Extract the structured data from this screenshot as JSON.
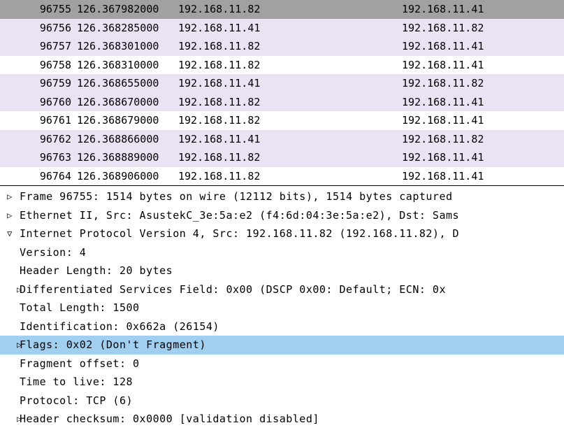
{
  "packet_list": {
    "rows": [
      {
        "no": "96755",
        "time": "126.367982000",
        "src": "192.168.11.82",
        "dst": "192.168.11.41",
        "style": "selected"
      },
      {
        "no": "96756",
        "time": "126.368285000",
        "src": "192.168.11.41",
        "dst": "192.168.11.82",
        "style": "alt"
      },
      {
        "no": "96757",
        "time": "126.368301000",
        "src": "192.168.11.82",
        "dst": "192.168.11.41",
        "style": "alt"
      },
      {
        "no": "96758",
        "time": "126.368310000",
        "src": "192.168.11.82",
        "dst": "192.168.11.41",
        "style": "plain"
      },
      {
        "no": "96759",
        "time": "126.368655000",
        "src": "192.168.11.41",
        "dst": "192.168.11.82",
        "style": "alt"
      },
      {
        "no": "96760",
        "time": "126.368670000",
        "src": "192.168.11.82",
        "dst": "192.168.11.41",
        "style": "alt"
      },
      {
        "no": "96761",
        "time": "126.368679000",
        "src": "192.168.11.82",
        "dst": "192.168.11.41",
        "style": "plain"
      },
      {
        "no": "96762",
        "time": "126.368866000",
        "src": "192.168.11.41",
        "dst": "192.168.11.82",
        "style": "alt"
      },
      {
        "no": "96763",
        "time": "126.368889000",
        "src": "192.168.11.82",
        "dst": "192.168.11.41",
        "style": "alt"
      },
      {
        "no": "96764",
        "time": "126.368906000",
        "src": "192.168.11.82",
        "dst": "192.168.11.41",
        "style": "plain"
      }
    ]
  },
  "details": {
    "lines": [
      {
        "twisty": "▷",
        "indent": 0,
        "text": "Frame 96755: 1514 bytes on wire (12112 bits), 1514 bytes captured",
        "selected": false
      },
      {
        "twisty": "▷",
        "indent": 0,
        "text": "Ethernet II, Src: AsustekC_3e:5a:e2 (f4:6d:04:3e:5a:e2), Dst: Sams",
        "selected": false
      },
      {
        "twisty": "▽",
        "indent": 0,
        "text": "Internet Protocol Version 4, Src: 192.168.11.82 (192.168.11.82), D",
        "selected": false
      },
      {
        "twisty": "",
        "indent": 1,
        "text": "Version: 4",
        "selected": false
      },
      {
        "twisty": "",
        "indent": 1,
        "text": "Header Length: 20 bytes",
        "selected": false
      },
      {
        "twisty": "▷",
        "indent": 1,
        "text": "Differentiated Services Field: 0x00 (DSCP 0x00: Default; ECN: 0x",
        "selected": false
      },
      {
        "twisty": "",
        "indent": 1,
        "text": "Total Length: 1500",
        "selected": false
      },
      {
        "twisty": "",
        "indent": 1,
        "text": "Identification: 0x662a (26154)",
        "selected": false
      },
      {
        "twisty": "▷",
        "indent": 1,
        "text": "Flags: 0x02 (Don't Fragment)",
        "selected": true
      },
      {
        "twisty": "",
        "indent": 1,
        "text": "Fragment offset: 0",
        "selected": false
      },
      {
        "twisty": "",
        "indent": 1,
        "text": "Time to live: 128",
        "selected": false
      },
      {
        "twisty": "",
        "indent": 1,
        "text": "Protocol: TCP (6)",
        "selected": false
      },
      {
        "twisty": "▷",
        "indent": 1,
        "text": "Header checksum: 0x0000 [validation disabled]",
        "selected": false
      }
    ]
  }
}
